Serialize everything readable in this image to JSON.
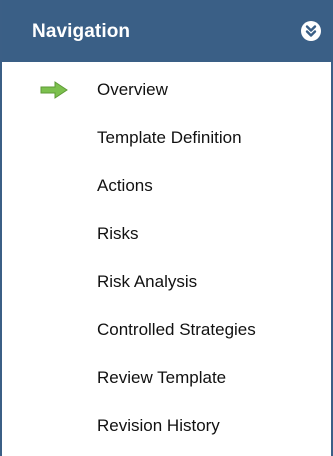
{
  "navigation": {
    "title": "Navigation",
    "collapse_icon": "double-chevron-down-icon",
    "current_indicator_icon": "green-arrow-right-icon",
    "current_index": 0,
    "items": [
      {
        "label": "Overview"
      },
      {
        "label": "Template Definition"
      },
      {
        "label": "Actions"
      },
      {
        "label": "Risks"
      },
      {
        "label": "Risk Analysis"
      },
      {
        "label": "Controlled Strategies"
      },
      {
        "label": "Review Template"
      },
      {
        "label": "Revision History"
      }
    ]
  },
  "colors": {
    "header_bg": "#3a5f86",
    "border": "#3b5f86",
    "arrow": "#7cc04e"
  }
}
